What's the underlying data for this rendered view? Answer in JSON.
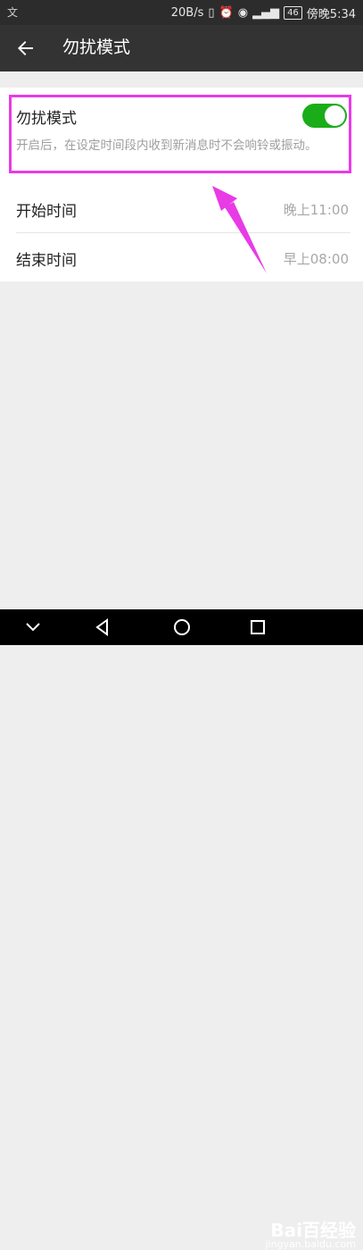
{
  "statusbar": {
    "left_icon": "文",
    "net_speed": "20B/s",
    "battery": "46",
    "time": "傍晚5:34"
  },
  "appbar": {
    "title": "勿扰模式"
  },
  "dnd": {
    "label": "勿扰模式",
    "description": "开启后，在设定时间段内收到新消息时不会响铃或振动。",
    "enabled": true
  },
  "schedule": {
    "start_label": "开始时间",
    "start_value": "晚上11:00",
    "end_label": "结束时间",
    "end_value": "早上08:00"
  },
  "watermark": {
    "brand": "Bai百经验",
    "url": "jingyan.baidu.com"
  },
  "colors": {
    "toggle_on": "#1aad19",
    "highlight": "#e83be6",
    "appbar": "#333333"
  }
}
